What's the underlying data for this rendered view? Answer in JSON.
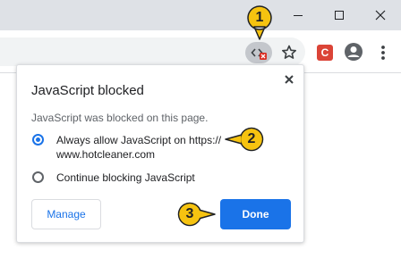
{
  "colors": {
    "accent": "#1a73e8",
    "badge_fill": "#f6c310",
    "badge_stroke": "#1f2124",
    "blocked_red": "#d93025",
    "ext_red": "#db4437"
  },
  "window_controls": {
    "minimize_icon": "minimize-icon",
    "maximize_icon": "maximize-icon",
    "close_icon": "close-icon"
  },
  "toolbar": {
    "js_blocked_icon": "javascript-blocked-icon",
    "bookmark_icon": "star-icon",
    "extension_label": "C",
    "profile_icon": "avatar-icon",
    "menu_icon": "more-vert-icon"
  },
  "popup": {
    "title": "JavaScript blocked",
    "description": "JavaScript was blocked on this page.",
    "options": [
      {
        "label": "Always allow JavaScript on https:// www.hotcleaner.com",
        "selected": true
      },
      {
        "label": "Continue blocking JavaScript",
        "selected": false
      }
    ],
    "manage_label": "Manage",
    "done_label": "Done"
  },
  "badges": [
    "1",
    "2",
    "3"
  ]
}
